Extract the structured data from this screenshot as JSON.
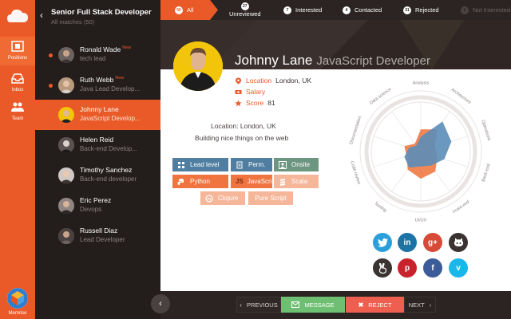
{
  "rail": {
    "items": [
      {
        "label": "Positions",
        "icon": "positions-icon",
        "active": true
      },
      {
        "label": "Inbox",
        "icon": "inbox-icon",
        "active": false
      },
      {
        "label": "Team",
        "icon": "team-icon",
        "active": false
      }
    ],
    "brand": "Memrise"
  },
  "list": {
    "title": "Senior Full Stack Developer",
    "subtitle": "All matches (50)",
    "candidates": [
      {
        "name": "Ronald Wade",
        "role": "tech lead",
        "new": "New",
        "unread": true
      },
      {
        "name": "Ruth Webb",
        "role": "Java Lead Develop...",
        "new": "New",
        "unread": true
      },
      {
        "name": "Johnny Lane",
        "role": "JavaScript Develop...",
        "new": "",
        "unread": false
      },
      {
        "name": "Helen Reid",
        "role": "Back-end Develop...",
        "new": "",
        "unread": false
      },
      {
        "name": "Timothy Sanchez",
        "role": "Back-end developer",
        "new": "",
        "unread": false
      },
      {
        "name": "Eric Perez",
        "role": "Devops",
        "new": "",
        "unread": false
      },
      {
        "name": "Russell Diaz",
        "role": "Lead Developer",
        "new": "",
        "unread": false
      }
    ]
  },
  "tabs": [
    {
      "count": "50",
      "label": "All"
    },
    {
      "count": "27",
      "label": "Unreviewed"
    },
    {
      "count": "7",
      "label": "Interested"
    },
    {
      "count": "4",
      "label": "Contacted"
    },
    {
      "count": "31",
      "label": "Rejected"
    },
    {
      "count": "0",
      "label": "Not Interested"
    }
  ],
  "profile": {
    "name": "Johnny Lane",
    "title": "JavaScript Developer",
    "location_label": "Location",
    "location_value": "London, UK",
    "salary_label": "Salary",
    "score_label": "Score",
    "score_value": "81",
    "location_line": "Location: London, UK",
    "bio": "Building nice things on the web",
    "tags": [
      {
        "label": "Lead level",
        "icon": "grid-icon",
        "style": "blue"
      },
      {
        "label": "Perm.",
        "icon": "document-icon",
        "style": "blue"
      },
      {
        "label": "Onsite",
        "icon": "user-icon",
        "style": "green"
      },
      {
        "label": "Python",
        "icon": "python-icon",
        "style": "orange"
      },
      {
        "label": "JavaScript",
        "icon": "js-icon",
        "style": "orange"
      },
      {
        "label": "Scala",
        "icon": "scala-icon",
        "style": "pale"
      },
      {
        "label": "Clojure",
        "icon": "clojure-icon",
        "style": "pale"
      },
      {
        "label": "Pure Script",
        "icon": "",
        "style": "pale"
      }
    ]
  },
  "radar": {
    "axes": [
      "Analysis",
      "Architecture",
      "Operations",
      "Back-end",
      "Front-end",
      "UI/UX",
      "Testing",
      "Code review",
      "Documentation",
      "Data science"
    ],
    "series": [
      {
        "color": "#ef7a45",
        "values": [
          0.45,
          0.55,
          0.3,
          0.35,
          0.5,
          0.55,
          0.45,
          0.3,
          0.35,
          0.2
        ]
      },
      {
        "color": "#5b8db8",
        "values": [
          0.3,
          0.75,
          0.65,
          0.5,
          0.35,
          0.3,
          0.4,
          0.35,
          0.25,
          0.15
        ]
      }
    ],
    "colors": {
      "ring": "#e9e4e2",
      "axis": "#e9e4e2",
      "label": "#8a827f"
    }
  },
  "social": [
    {
      "name": "twitter",
      "glyph": "t",
      "color": "#2b9fd9"
    },
    {
      "name": "linkedin",
      "glyph": "in",
      "color": "#1c74a6"
    },
    {
      "name": "google-plus",
      "glyph": "g+",
      "color": "#d84a38"
    },
    {
      "name": "github",
      "glyph": "gh",
      "color": "#3a3332"
    },
    {
      "name": "angellist",
      "glyph": "v",
      "color": "#3a3332"
    },
    {
      "name": "pinterest",
      "glyph": "p",
      "color": "#c8232c"
    },
    {
      "name": "facebook",
      "glyph": "f",
      "color": "#3b5b99"
    },
    {
      "name": "vimeo",
      "glyph": "v",
      "color": "#1ab7ea"
    }
  ],
  "actions": {
    "previous": "PREVIOUS",
    "message": "MESSAGE",
    "reject": "REJECT",
    "next": "NEXT"
  },
  "colors": {
    "accent": "#ea5a28"
  }
}
